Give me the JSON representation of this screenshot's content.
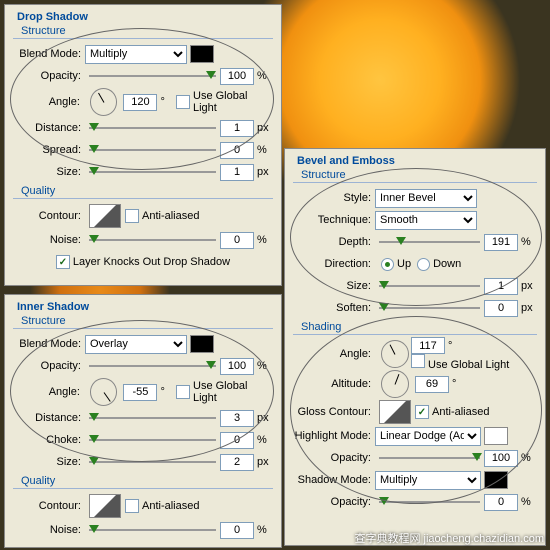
{
  "panels": {
    "dropShadow": {
      "title": "Drop Shadow",
      "structure": "Structure",
      "quality": "Quality",
      "blendMode": {
        "label": "Blend Mode:",
        "value": "Multiply"
      },
      "opacity": {
        "label": "Opacity:",
        "value": "100",
        "unit": "%"
      },
      "angle": {
        "label": "Angle:",
        "value": "120",
        "unit": "°"
      },
      "useGlobal": "Use Global Light",
      "distance": {
        "label": "Distance:",
        "value": "1",
        "unit": "px"
      },
      "spread": {
        "label": "Spread:",
        "value": "0",
        "unit": "%"
      },
      "size": {
        "label": "Size:",
        "value": "1",
        "unit": "px"
      },
      "contour": "Contour:",
      "antialiased": "Anti-aliased",
      "noise": {
        "label": "Noise:",
        "value": "0",
        "unit": "%"
      },
      "knockout": "Layer Knocks Out Drop Shadow"
    },
    "innerShadow": {
      "title": "Inner Shadow",
      "structure": "Structure",
      "quality": "Quality",
      "blendMode": {
        "label": "Blend Mode:",
        "value": "Overlay"
      },
      "opacity": {
        "label": "Opacity:",
        "value": "100",
        "unit": "%"
      },
      "angle": {
        "label": "Angle:",
        "value": "-55",
        "unit": "°"
      },
      "useGlobal": "Use Global Light",
      "distance": {
        "label": "Distance:",
        "value": "3",
        "unit": "px"
      },
      "choke": {
        "label": "Choke:",
        "value": "0",
        "unit": "%"
      },
      "size": {
        "label": "Size:",
        "value": "2",
        "unit": "px"
      },
      "contour": "Contour:",
      "antialiased": "Anti-aliased",
      "noise": {
        "label": "Noise:",
        "value": "0",
        "unit": "%"
      }
    },
    "bevel": {
      "title": "Bevel and Emboss",
      "structure": "Structure",
      "shading": "Shading",
      "style": {
        "label": "Style:",
        "value": "Inner Bevel"
      },
      "technique": {
        "label": "Technique:",
        "value": "Smooth"
      },
      "depth": {
        "label": "Depth:",
        "value": "191",
        "unit": "%"
      },
      "direction": {
        "label": "Direction:",
        "up": "Up",
        "down": "Down"
      },
      "size": {
        "label": "Size:",
        "value": "1",
        "unit": "px"
      },
      "soften": {
        "label": "Soften:",
        "value": "0",
        "unit": "px"
      },
      "angle": {
        "label": "Angle:",
        "value": "117",
        "unit": "°"
      },
      "useGlobal": "Use Global Light",
      "altitude": {
        "label": "Altitude:",
        "value": "69",
        "unit": "°"
      },
      "glossContour": "Gloss Contour:",
      "antialiased": "Anti-aliased",
      "highlight": {
        "label": "Highlight Mode:",
        "value": "Linear Dodge (Add)",
        "opacity": "Opacity:",
        "opval": "100",
        "unit": "%"
      },
      "shadow": {
        "label": "Shadow Mode:",
        "value": "Multiply",
        "opacity": "Opacity:",
        "opval": "0",
        "unit": "%"
      }
    }
  },
  "watermark": "查字典教程网 jiaocheng.chazidian.com"
}
